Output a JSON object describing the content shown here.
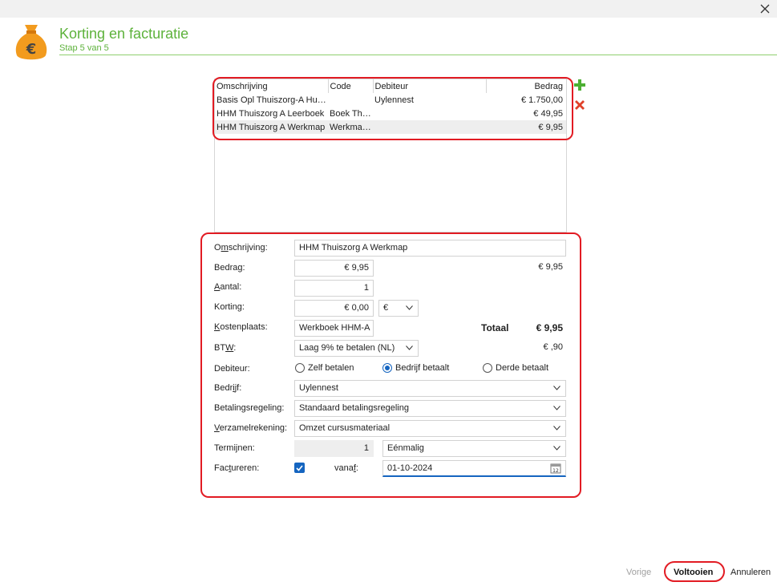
{
  "window": {
    "close_icon": "close-icon"
  },
  "header": {
    "title": "Korting en facturatie",
    "subtitle": "Stap 5 van 5",
    "icon": "money-bag-euro-icon",
    "accent": "#5db23b"
  },
  "grid": {
    "columns": [
      "Omschrijving",
      "Code",
      "Debiteur",
      "Bedrag"
    ],
    "rows": [
      [
        "Basis Opl Thuiszorg-A Huiswerk",
        "",
        "Uylennest",
        "€ 1.750,00"
      ],
      [
        "HHM Thuiszorg A Leerboek",
        "Boek Thuiszorg",
        "",
        "€ 49,95"
      ],
      [
        "HHM Thuiszorg A Werkmap",
        "Werkmap HHM-A",
        "",
        "€ 9,95"
      ]
    ],
    "add_icon": "plus-icon",
    "delete_icon": "delete-x-icon"
  },
  "form": {
    "omschrijving": {
      "label_pre": "O",
      "label_u": "m",
      "label_post": "schrijving:",
      "value": "HHM Thuiszorg A Werkmap"
    },
    "bedrag": {
      "label_pre": "Bedra",
      "label_u": "g",
      "label_post": ":",
      "value": "€ 9,95",
      "right_value": "€ 9,95"
    },
    "aantal": {
      "label_pre": "",
      "label_u": "A",
      "label_post": "antal:",
      "value": "1"
    },
    "korting": {
      "label": "Korting:",
      "value": "€ 0,00",
      "unit": "€"
    },
    "kostenplaats": {
      "label_pre": "",
      "label_u": "K",
      "label_post": "ostenplaats:",
      "value": "Werkboek HHM-A"
    },
    "totaal": {
      "label": "Totaal",
      "value": "€ 9,95"
    },
    "btw": {
      "label_pre": "BT",
      "label_u": "W",
      "label_post": ":",
      "value": "Laag 9% te betalen (NL)",
      "right_value": "€ ,90"
    },
    "debiteur": {
      "label": "Debiteur:",
      "options": [
        "Zelf betalen",
        "Bedrijf betaalt",
        "Derde betaalt"
      ],
      "selected": "Bedrijf betaalt"
    },
    "bedrijf": {
      "label_pre": "Bedr",
      "label_u": "i",
      "label_post": "jf:",
      "value": "Uylennest"
    },
    "betalingsregeling": {
      "label": "Betalingsregeling:",
      "value": "Standaard betalingsregeling"
    },
    "verzamelrekening": {
      "label_pre": "",
      "label_u": "V",
      "label_post": "erzamelrekening:",
      "value": "Omzet cursusmateriaal"
    },
    "termijnen": {
      "label": "Termijnen:",
      "value": "1",
      "frequency": "Eénmalig"
    },
    "factureren": {
      "label_pre": "Fac",
      "label_u": "t",
      "label_post": "ureren:",
      "checked": true,
      "vanaf_label_pre": "vana",
      "vanaf_label_u": "f",
      "vanaf_label_post": ":",
      "date": "01-10-2024",
      "calendar_icon": "calendar-icon"
    }
  },
  "footer": {
    "vorige": "Vorige",
    "voltooien": "Voltooien",
    "annuleren": "Annuleren"
  },
  "colors": {
    "highlight": "#e21b23",
    "accent_blue": "#1565c0"
  }
}
